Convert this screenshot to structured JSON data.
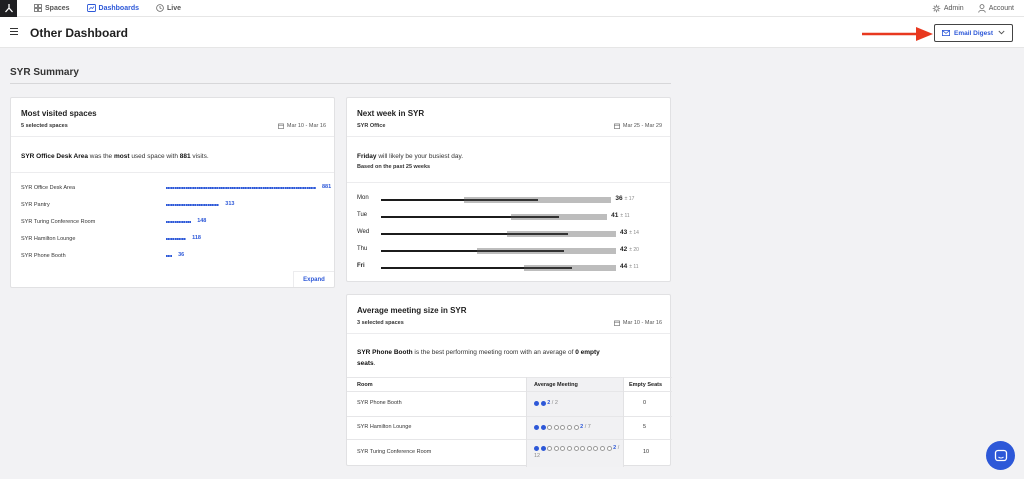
{
  "nav": {
    "items": [
      {
        "label": "Spaces",
        "icon": "grid-icon",
        "active": false
      },
      {
        "label": "Dashboards",
        "icon": "dashboard-icon",
        "active": true
      },
      {
        "label": "Live",
        "icon": "clock-icon",
        "active": false
      }
    ],
    "right": [
      {
        "label": "Admin",
        "icon": "gear-icon"
      },
      {
        "label": "Account",
        "icon": "person-icon"
      }
    ]
  },
  "header": {
    "title": "Other Dashboard",
    "email_digest_label": "Email Digest"
  },
  "section": {
    "title": "SYR Summary"
  },
  "most_visited": {
    "title": "Most visited spaces",
    "subtitle": "5 selected spaces",
    "date_range": "Mar 10 - Mar 16",
    "summary_space": "SYR Office Desk Area",
    "summary_mid": " was the ",
    "summary_most": "most",
    "summary_mid2": " used space with ",
    "summary_count": "881",
    "summary_end": " visits.",
    "rows": [
      {
        "label": "SYR Office Desk Area",
        "value": 881
      },
      {
        "label": "SYR Pantry",
        "value": 313
      },
      {
        "label": "SYR Turing Conference Room",
        "value": 148
      },
      {
        "label": "SYR Hamilton Lounge",
        "value": 118
      },
      {
        "label": "SYR Phone Booth",
        "value": 36
      }
    ],
    "max_value": 881,
    "expand_label": "Expand"
  },
  "next_week": {
    "title": "Next week in SYR",
    "subtitle": "SYR Office",
    "date_range": "Mar 25 - Mar 29",
    "summary_day": "Friday",
    "summary_text": " will likely be your busiest day.",
    "summary_note": "Based on the past 25 weeks",
    "scale_max": 46,
    "rows": [
      {
        "day": "Mon",
        "value": 36,
        "pm": "± 17",
        "bold": false
      },
      {
        "day": "Tue",
        "value": 41,
        "pm": "± 11",
        "bold": false
      },
      {
        "day": "Wed",
        "value": 43,
        "pm": "± 14",
        "bold": false
      },
      {
        "day": "Thu",
        "value": 42,
        "pm": "± 20",
        "bold": false
      },
      {
        "day": "Fri",
        "value": 44,
        "pm": "± 11",
        "bold": true
      }
    ]
  },
  "avg_meeting": {
    "title": "Average meeting size in SYR",
    "subtitle": "3 selected spaces",
    "date_range": "Mar 10 - Mar 16",
    "summary_room": "SYR Phone Booth",
    "summary_text1": " is the best performing meeting room with an average of ",
    "summary_seats": "0 empty",
    "summary_seats2": "seats",
    "summary_end": ".",
    "columns": [
      "Room",
      "Average Meeting",
      "Empty Seats"
    ],
    "rows": [
      {
        "room": "SYR Phone Booth",
        "avg": 2,
        "capacity": 2,
        "capacity_label": "/ 2",
        "empty": "0"
      },
      {
        "room": "SYR Hamilton Lounge",
        "avg": 2,
        "capacity": 7,
        "capacity_label": "/ 7",
        "empty": "5"
      },
      {
        "room": "SYR Turing Conference Room",
        "avg": 2,
        "capacity": 12,
        "capacity_label": "/ 12",
        "empty": "10"
      }
    ]
  },
  "colors": {
    "accent": "#2d58d8",
    "annotation_arrow": "#e8381f"
  }
}
